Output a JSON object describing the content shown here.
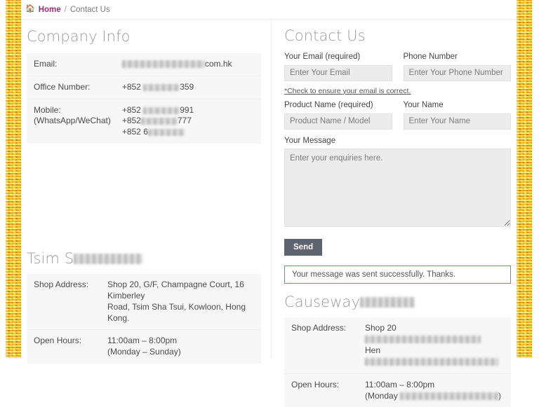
{
  "breadcrumb": {
    "home_icon": "home-icon",
    "home_label": "Home",
    "separator": "/",
    "current": "Contact Us"
  },
  "company_info": {
    "title": "Company Info",
    "rows": [
      {
        "label": "Email:",
        "redacted_before": true,
        "redact_w": 118,
        "value": "com.hk",
        "extra_lines": []
      },
      {
        "label": "Office Number:",
        "value": "+852 2##7 #359",
        "prefix": "+852",
        "suffix": "359"
      },
      {
        "label": "Mobile:\n(WhatsApp/WeChat)",
        "label_line1": "Mobile:",
        "label_line2": "(WhatsApp/WeChat)",
        "lines": [
          {
            "prefix": "+852",
            "redact_w": 52,
            "suffix": "991"
          },
          {
            "prefix": "+852",
            "redact_w": 52,
            "suffix": "777"
          },
          {
            "prefix": "+852 6",
            "redact_w": 52,
            "suffix": ""
          }
        ]
      }
    ]
  },
  "contact_form": {
    "title": "Contact Us",
    "fields": {
      "email": {
        "label": "Your Email (required)",
        "placeholder": "Enter Your Email",
        "value": ""
      },
      "phone": {
        "label": "Phone Number",
        "placeholder": "Enter Your Phone Number",
        "value": ""
      },
      "product": {
        "label": "Product Name (required)",
        "placeholder": "Product Name / Model",
        "value": ""
      },
      "name": {
        "label": "Your Name",
        "placeholder": "Enter Your Name",
        "value": ""
      },
      "message": {
        "label": "Your Message",
        "placeholder": "Enter your enquiries here.",
        "value": ""
      }
    },
    "email_note": "*Check to ensure your email is correct.",
    "send_label": "Send",
    "success_message": "Your message was sent successfully. Thanks.",
    "success_border_color": "#49b14f",
    "send_button_color": "#5d6470"
  },
  "shop_left": {
    "title_visible": "Tsim S",
    "title_full": "Tsim Sha Tsui Shop",
    "address_label": "Shop Address:",
    "address_line1": "Shop 20, G/F, Champagne Court, 16 Kimberley",
    "address_line2": "Road, Tsim Sha Tsui, Kowloon, Hong Kong.",
    "hours_label": "Open Hours:",
    "hours_line1": "11:00am – 8:00pm",
    "hours_line2": "(Monday – Sunday)"
  },
  "shop_right": {
    "title_visible": "Causeway",
    "title_full": "Causeway Bay Shop",
    "address_label": "Shop Address:",
    "address_line1_prefix": "Shop 20",
    "address_line2_prefix": "Hen",
    "hours_label": "Open Hours:",
    "hours_line1": "11:00am – 8:00pm",
    "hours_line2_prefix": "(Monday",
    "hours_line2_suffix": ")"
  },
  "theme": {
    "accent_purple": "#9b2d72",
    "heading_gray": "#9b9b9b",
    "field_bg": "#ececec",
    "table_bg": "#f7f7f7",
    "glitter_gold": "#d9ae55"
  }
}
